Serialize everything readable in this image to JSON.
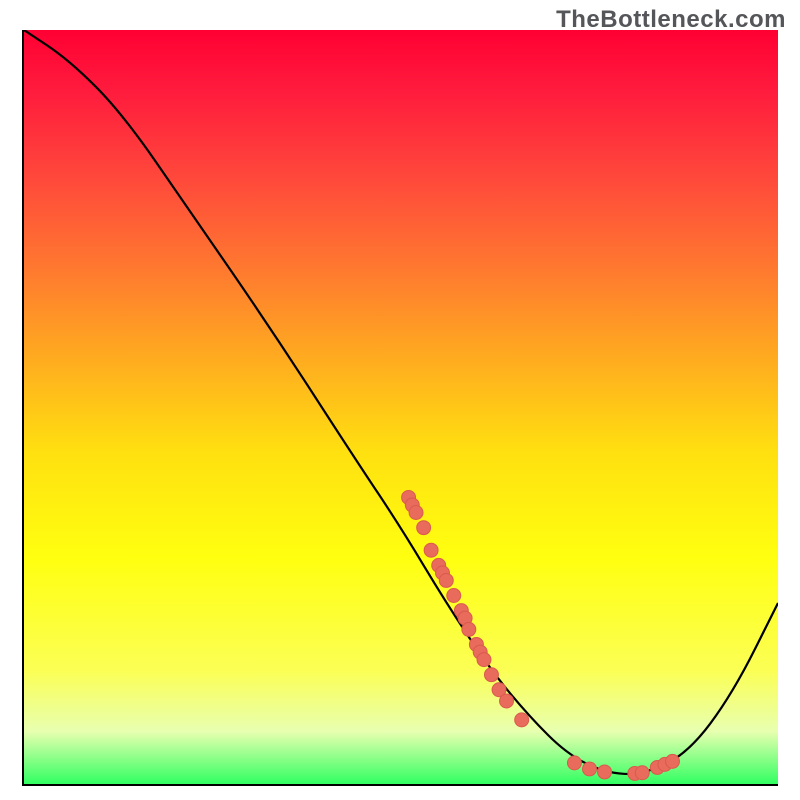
{
  "watermark": "TheBottleneck.com",
  "chart_data": {
    "type": "line",
    "title": "",
    "xlabel": "",
    "ylabel": "",
    "xlim": [
      0,
      100
    ],
    "ylim": [
      0,
      100
    ],
    "curve": [
      {
        "x": 0,
        "y": 100
      },
      {
        "x": 6,
        "y": 96
      },
      {
        "x": 13,
        "y": 89
      },
      {
        "x": 22,
        "y": 76
      },
      {
        "x": 33,
        "y": 60
      },
      {
        "x": 44,
        "y": 43
      },
      {
        "x": 50,
        "y": 34
      },
      {
        "x": 56,
        "y": 24
      },
      {
        "x": 62,
        "y": 15
      },
      {
        "x": 67,
        "y": 9
      },
      {
        "x": 72,
        "y": 4
      },
      {
        "x": 77,
        "y": 1.5
      },
      {
        "x": 82,
        "y": 1.2
      },
      {
        "x": 88,
        "y": 4
      },
      {
        "x": 94,
        "y": 12
      },
      {
        "x": 100,
        "y": 24
      }
    ],
    "scatter_points": [
      {
        "x": 51,
        "y": 38
      },
      {
        "x": 51.5,
        "y": 37
      },
      {
        "x": 52,
        "y": 36
      },
      {
        "x": 53,
        "y": 34
      },
      {
        "x": 54,
        "y": 31
      },
      {
        "x": 55,
        "y": 29
      },
      {
        "x": 55.5,
        "y": 28
      },
      {
        "x": 56,
        "y": 27
      },
      {
        "x": 57,
        "y": 25
      },
      {
        "x": 58,
        "y": 23
      },
      {
        "x": 58.5,
        "y": 22
      },
      {
        "x": 59,
        "y": 20.5
      },
      {
        "x": 60,
        "y": 18.5
      },
      {
        "x": 60.5,
        "y": 17.5
      },
      {
        "x": 61,
        "y": 16.5
      },
      {
        "x": 62,
        "y": 14.5
      },
      {
        "x": 63,
        "y": 12.5
      },
      {
        "x": 64,
        "y": 11
      },
      {
        "x": 66,
        "y": 8.5
      },
      {
        "x": 73,
        "y": 2.8
      },
      {
        "x": 75,
        "y": 2.0
      },
      {
        "x": 77,
        "y": 1.6
      },
      {
        "x": 81,
        "y": 1.4
      },
      {
        "x": 82,
        "y": 1.5
      },
      {
        "x": 84,
        "y": 2.2
      },
      {
        "x": 85,
        "y": 2.6
      },
      {
        "x": 86,
        "y": 3.0
      }
    ],
    "colors": {
      "curve": "#000000",
      "dots": "#e86b5c",
      "background_top": "#ff0033",
      "background_bottom": "#32ff62"
    }
  }
}
